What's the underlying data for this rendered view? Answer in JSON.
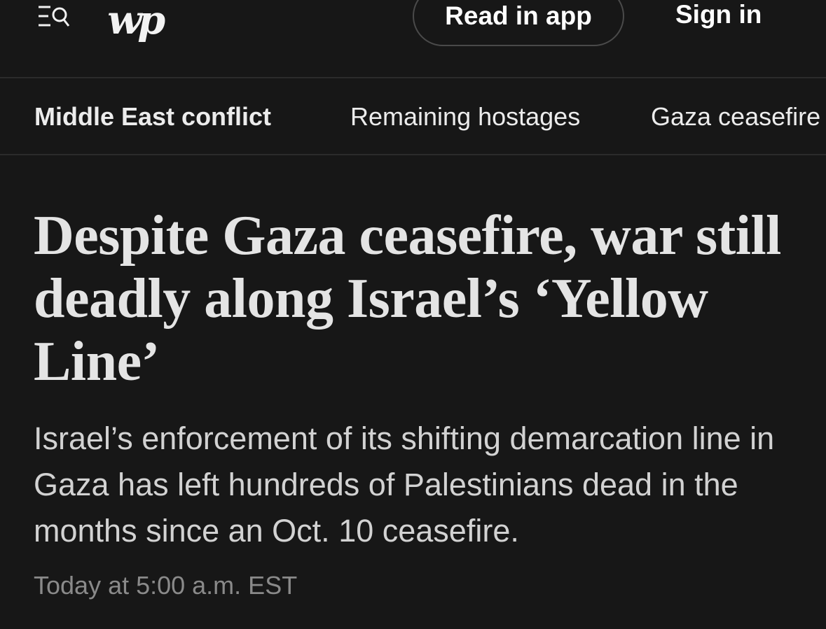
{
  "header": {
    "logo_text": "wp",
    "read_in_app_label": "Read in app",
    "sign_in_label": "Sign in",
    "menu_icon": "menu-search-icon"
  },
  "nav": {
    "items": [
      {
        "label": "Middle East conflict",
        "active": true
      },
      {
        "label": "Remaining hostages",
        "active": false
      },
      {
        "label": "Gaza ceasefire",
        "active": false
      }
    ]
  },
  "article": {
    "headline": "Despite Gaza ceasefire, war still deadly along Israel’s ‘Yellow Line’",
    "dek": "Israel’s enforcement of its shifting demarcation line in Gaza has left hundreds of Palestinians dead in the months since an Oct. 10 ceasefire.",
    "timestamp": "Today at 5:00 a.m. EST"
  },
  "colors": {
    "background": "#171717",
    "divider": "#2b2b2b",
    "headline": "#e4e4e4",
    "timestamp": "#8a8a8a"
  }
}
